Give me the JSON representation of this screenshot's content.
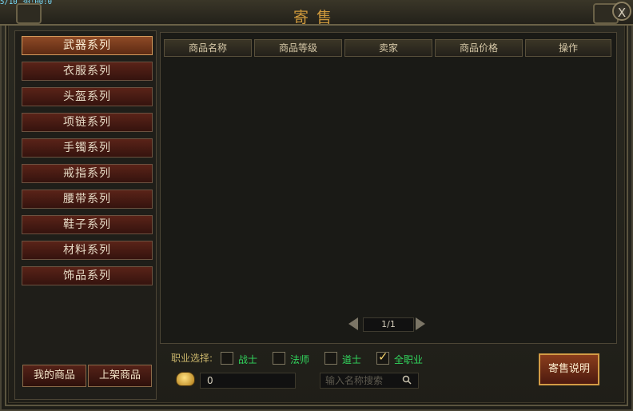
{
  "window": {
    "title": "寄售",
    "top_strip_text": "5/10 30:00:0",
    "close_label": "X"
  },
  "categories": [
    {
      "label": "武器系列",
      "active": true
    },
    {
      "label": "衣服系列",
      "active": false
    },
    {
      "label": "头盔系列",
      "active": false
    },
    {
      "label": "项链系列",
      "active": false
    },
    {
      "label": "手镯系列",
      "active": false
    },
    {
      "label": "戒指系列",
      "active": false
    },
    {
      "label": "腰带系列",
      "active": false
    },
    {
      "label": "鞋子系列",
      "active": false
    },
    {
      "label": "材料系列",
      "active": false
    },
    {
      "label": "饰品系列",
      "active": false
    }
  ],
  "left_buttons": {
    "my_items": "我的商品",
    "list_item": "上架商品"
  },
  "table": {
    "headers": [
      "商品名称",
      "商品等级",
      "卖家",
      "商品价格",
      "操作"
    ],
    "rows": []
  },
  "pagination": {
    "page": "1/1"
  },
  "filters": {
    "job_label": "职业选择:",
    "jobs": [
      {
        "label": "战士",
        "checked": false
      },
      {
        "label": "法师",
        "checked": false
      },
      {
        "label": "道士",
        "checked": false
      },
      {
        "label": "全职业",
        "checked": true
      }
    ]
  },
  "money": {
    "value": "0"
  },
  "search": {
    "placeholder": "输入名称搜索"
  },
  "info_button": "寄售说明",
  "colors": {
    "accent": "#d09a3c",
    "active_category": "#8e4a26",
    "job_text": "#31d65d"
  }
}
